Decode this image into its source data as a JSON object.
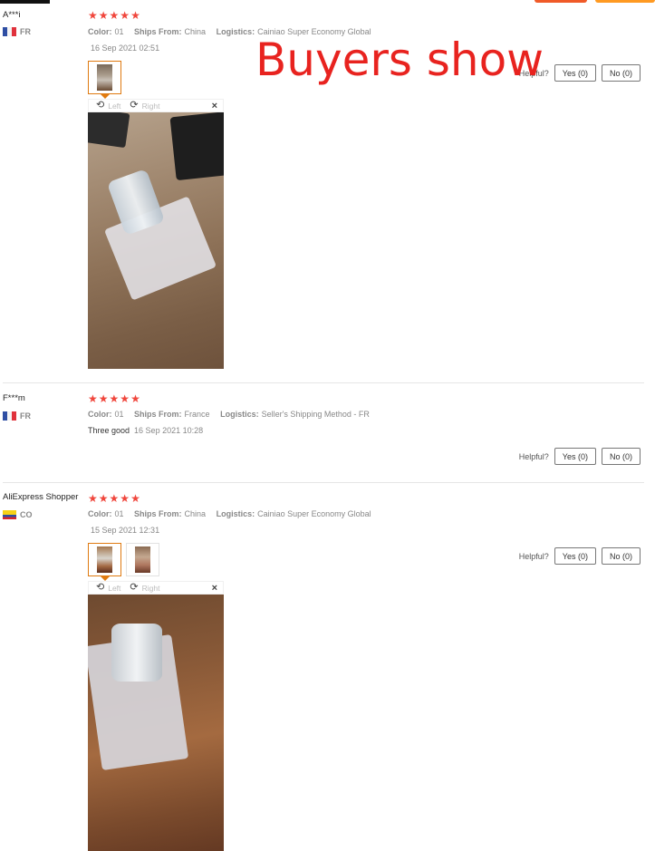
{
  "overlay_title": "Buyers show",
  "helpful_label": "Helpful?",
  "viewer": {
    "left_label": "Left",
    "right_label": "Right",
    "close_glyph": "×"
  },
  "meta_keys": {
    "color": "Color:",
    "ships_from": "Ships From:",
    "logistics": "Logistics:"
  },
  "reviews": [
    {
      "user": "A***i",
      "country": "FR",
      "flag_colors": [
        "#2e4ea3",
        "#f4f4f4",
        "#e0323c"
      ],
      "stars": 5,
      "color": "01",
      "ships_from": "China",
      "logistics": "Cainiao Super Economy Global",
      "text": "",
      "date": "16 Sep 2021 02:51",
      "photos": 1,
      "yes": "Yes (0)",
      "no": "No (0)"
    },
    {
      "user": "F***m",
      "country": "FR",
      "flag_colors": [
        "#2e4ea3",
        "#f4f4f4",
        "#e0323c"
      ],
      "stars": 5,
      "color": "01",
      "ships_from": "France",
      "logistics": "Seller's Shipping Method - FR",
      "text": "Three good",
      "date": "16 Sep 2021 10:28",
      "photos": 0,
      "yes": "Yes (0)",
      "no": "No (0)"
    },
    {
      "user": "AliExpress Shopper",
      "country": "CO",
      "flag_colors": [
        "#f7d116",
        "#2e4ea3",
        "#d7262c"
      ],
      "stars": 5,
      "color": "01",
      "ships_from": "China",
      "logistics": "Cainiao Super Economy Global",
      "text": "",
      "date": "15 Sep 2021 12:31",
      "photos": 2,
      "yes": "Yes (0)",
      "no": "No (0)"
    }
  ],
  "star_color": "#f0463c",
  "accent_color": "#e07a10",
  "overlay_color": "#e8231f"
}
